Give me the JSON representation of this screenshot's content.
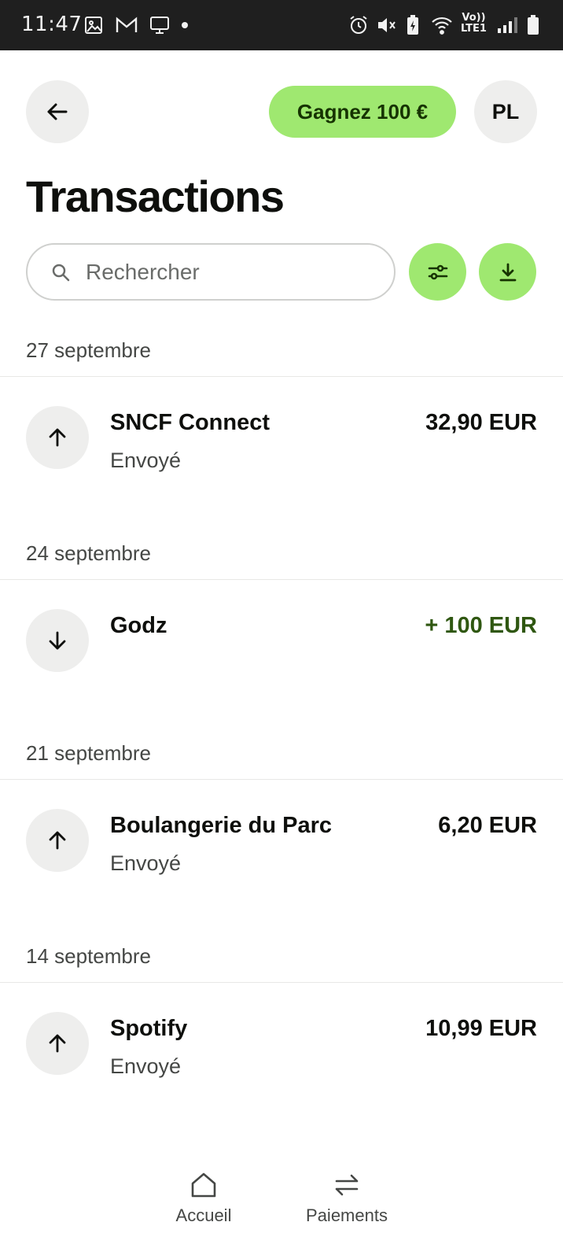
{
  "status_bar": {
    "time": "11:47",
    "network": "Vo))\nLTE1",
    "icons": [
      "image-icon",
      "gmail-icon",
      "cast-icon",
      "dot-icon",
      "alarm-icon",
      "mute-icon",
      "battery-saver-icon",
      "wifi-icon",
      "signal-icon",
      "battery-icon"
    ]
  },
  "header": {
    "promo_label": "Gagnez 100 €",
    "avatar_initials": "PL",
    "title": "Transactions"
  },
  "search": {
    "placeholder": "Rechercher"
  },
  "colors": {
    "accent": "#9fe870",
    "accent_text": "#163300",
    "positive_amount": "#2f5711"
  },
  "groups": [
    {
      "date": "27 septembre",
      "transactions": [
        {
          "name": "SNCF Connect",
          "status": "Envoyé",
          "amount": "32,90 EUR",
          "direction": "out"
        }
      ]
    },
    {
      "date": "24 septembre",
      "transactions": [
        {
          "name": "Godz",
          "status": "",
          "amount": "+ 100 EUR",
          "direction": "in"
        }
      ]
    },
    {
      "date": "21 septembre",
      "transactions": [
        {
          "name": "Boulangerie du Parc",
          "status": "Envoyé",
          "amount": "6,20 EUR",
          "direction": "out"
        }
      ]
    },
    {
      "date": "14 septembre",
      "transactions": [
        {
          "name": "Spotify",
          "status": "Envoyé",
          "amount": "10,99 EUR",
          "direction": "out"
        }
      ]
    }
  ],
  "bottom_nav": [
    {
      "label": "Accueil",
      "icon": "home-icon"
    },
    {
      "label": "Paiements",
      "icon": "transfer-icon"
    }
  ]
}
